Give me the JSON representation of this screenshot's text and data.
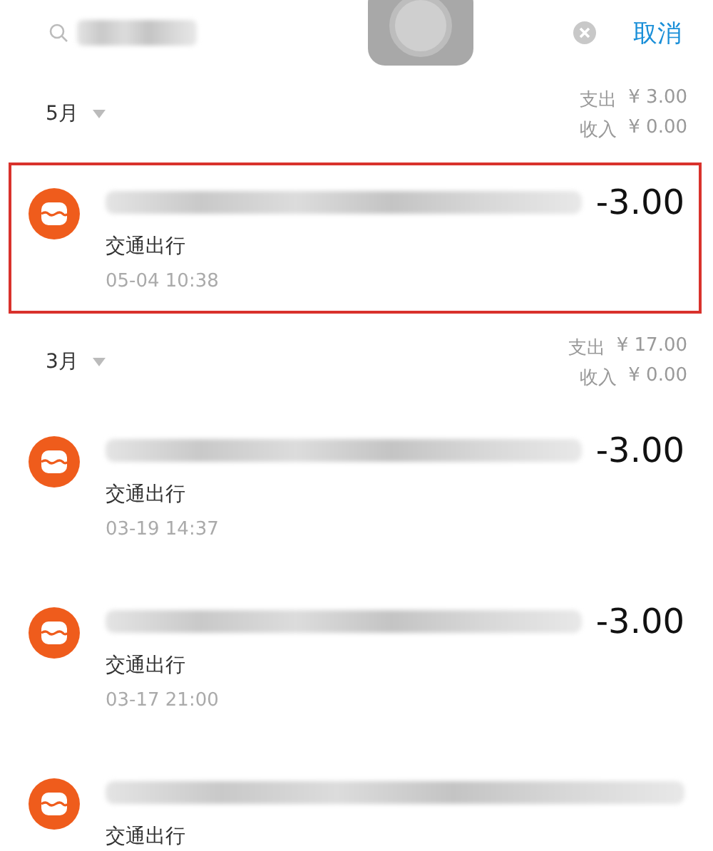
{
  "search": {
    "cancel": "取消"
  },
  "groups": [
    {
      "month": "5月",
      "totals": [
        {
          "label": "支出",
          "value": "¥ 3.00"
        },
        {
          "label": "收入",
          "value": "¥ 0.00"
        }
      ],
      "transactions": [
        {
          "category": "交通出行",
          "time": "05-04  10:38",
          "amount": "-3.00",
          "selected": true
        }
      ]
    },
    {
      "month": "3月",
      "totals": [
        {
          "label": "支出",
          "value": "¥ 17.00"
        },
        {
          "label": "收入",
          "value": "¥ 0.00"
        }
      ],
      "transactions": [
        {
          "category": "交通出行",
          "time": "03-19  14:37",
          "amount": "-3.00",
          "selected": false
        },
        {
          "category": "交通出行",
          "time": "03-17  21:00",
          "amount": "-3.00",
          "selected": false
        },
        {
          "category": "交通出行",
          "selected": false
        }
      ]
    }
  ]
}
